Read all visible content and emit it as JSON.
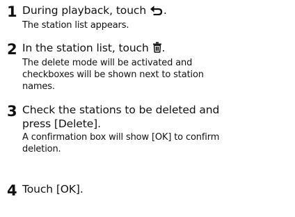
{
  "steps": [
    {
      "number": "1",
      "instruction_before_icon": "During playback, touch ",
      "instruction_icon": "back-arrow-icon",
      "instruction_after_icon": ".",
      "result_lines": [
        "The station list appears."
      ]
    },
    {
      "number": "2",
      "instruction_before_icon": "In the station list, touch ",
      "instruction_icon": "trash-icon",
      "instruction_after_icon": ".",
      "result_lines": [
        "The delete mode will be activated and",
        "checkboxes will be shown next to station",
        "names."
      ]
    },
    {
      "number": "3",
      "instruction_lines": [
        "Check the stations to be deleted and",
        "press [Delete]."
      ],
      "result_lines": [
        "A confirmation box will show [OK] to confirm",
        "deletion."
      ]
    },
    {
      "number": "4",
      "instruction_lines": [
        "Touch [OK]."
      ],
      "result_lines": []
    }
  ]
}
